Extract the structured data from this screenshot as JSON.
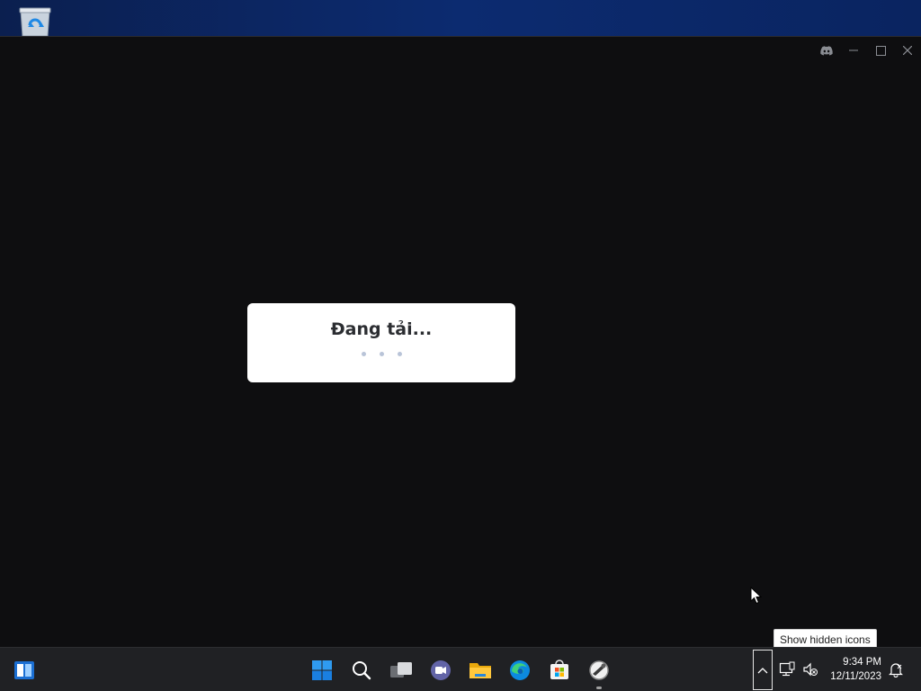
{
  "desktop": {
    "icons": [
      {
        "name": "recycle-bin-icon"
      }
    ]
  },
  "window": {
    "controls": {
      "discord": "discord-icon",
      "minimize": "minimize-icon",
      "maximize": "maximize-icon",
      "close": "close-icon"
    }
  },
  "loading": {
    "text": "Đang tải..."
  },
  "tooltip": {
    "text": "Show hidden icons"
  },
  "taskbar": {
    "apps": [
      {
        "name": "start",
        "icon": "windows-start-icon"
      },
      {
        "name": "search",
        "icon": "search-icon"
      },
      {
        "name": "task-view",
        "icon": "task-view-icon"
      },
      {
        "name": "chat",
        "icon": "teams-chat-icon"
      },
      {
        "name": "file-explorer",
        "icon": "folder-icon"
      },
      {
        "name": "edge",
        "icon": "edge-icon"
      },
      {
        "name": "store",
        "icon": "store-icon"
      },
      {
        "name": "discord-installer",
        "icon": "installer-icon",
        "running": true
      }
    ],
    "clock": {
      "time": "9:34 PM",
      "date": "12/11/2023"
    },
    "colors": {
      "accent": "#0078d4",
      "background": "#202124"
    }
  }
}
